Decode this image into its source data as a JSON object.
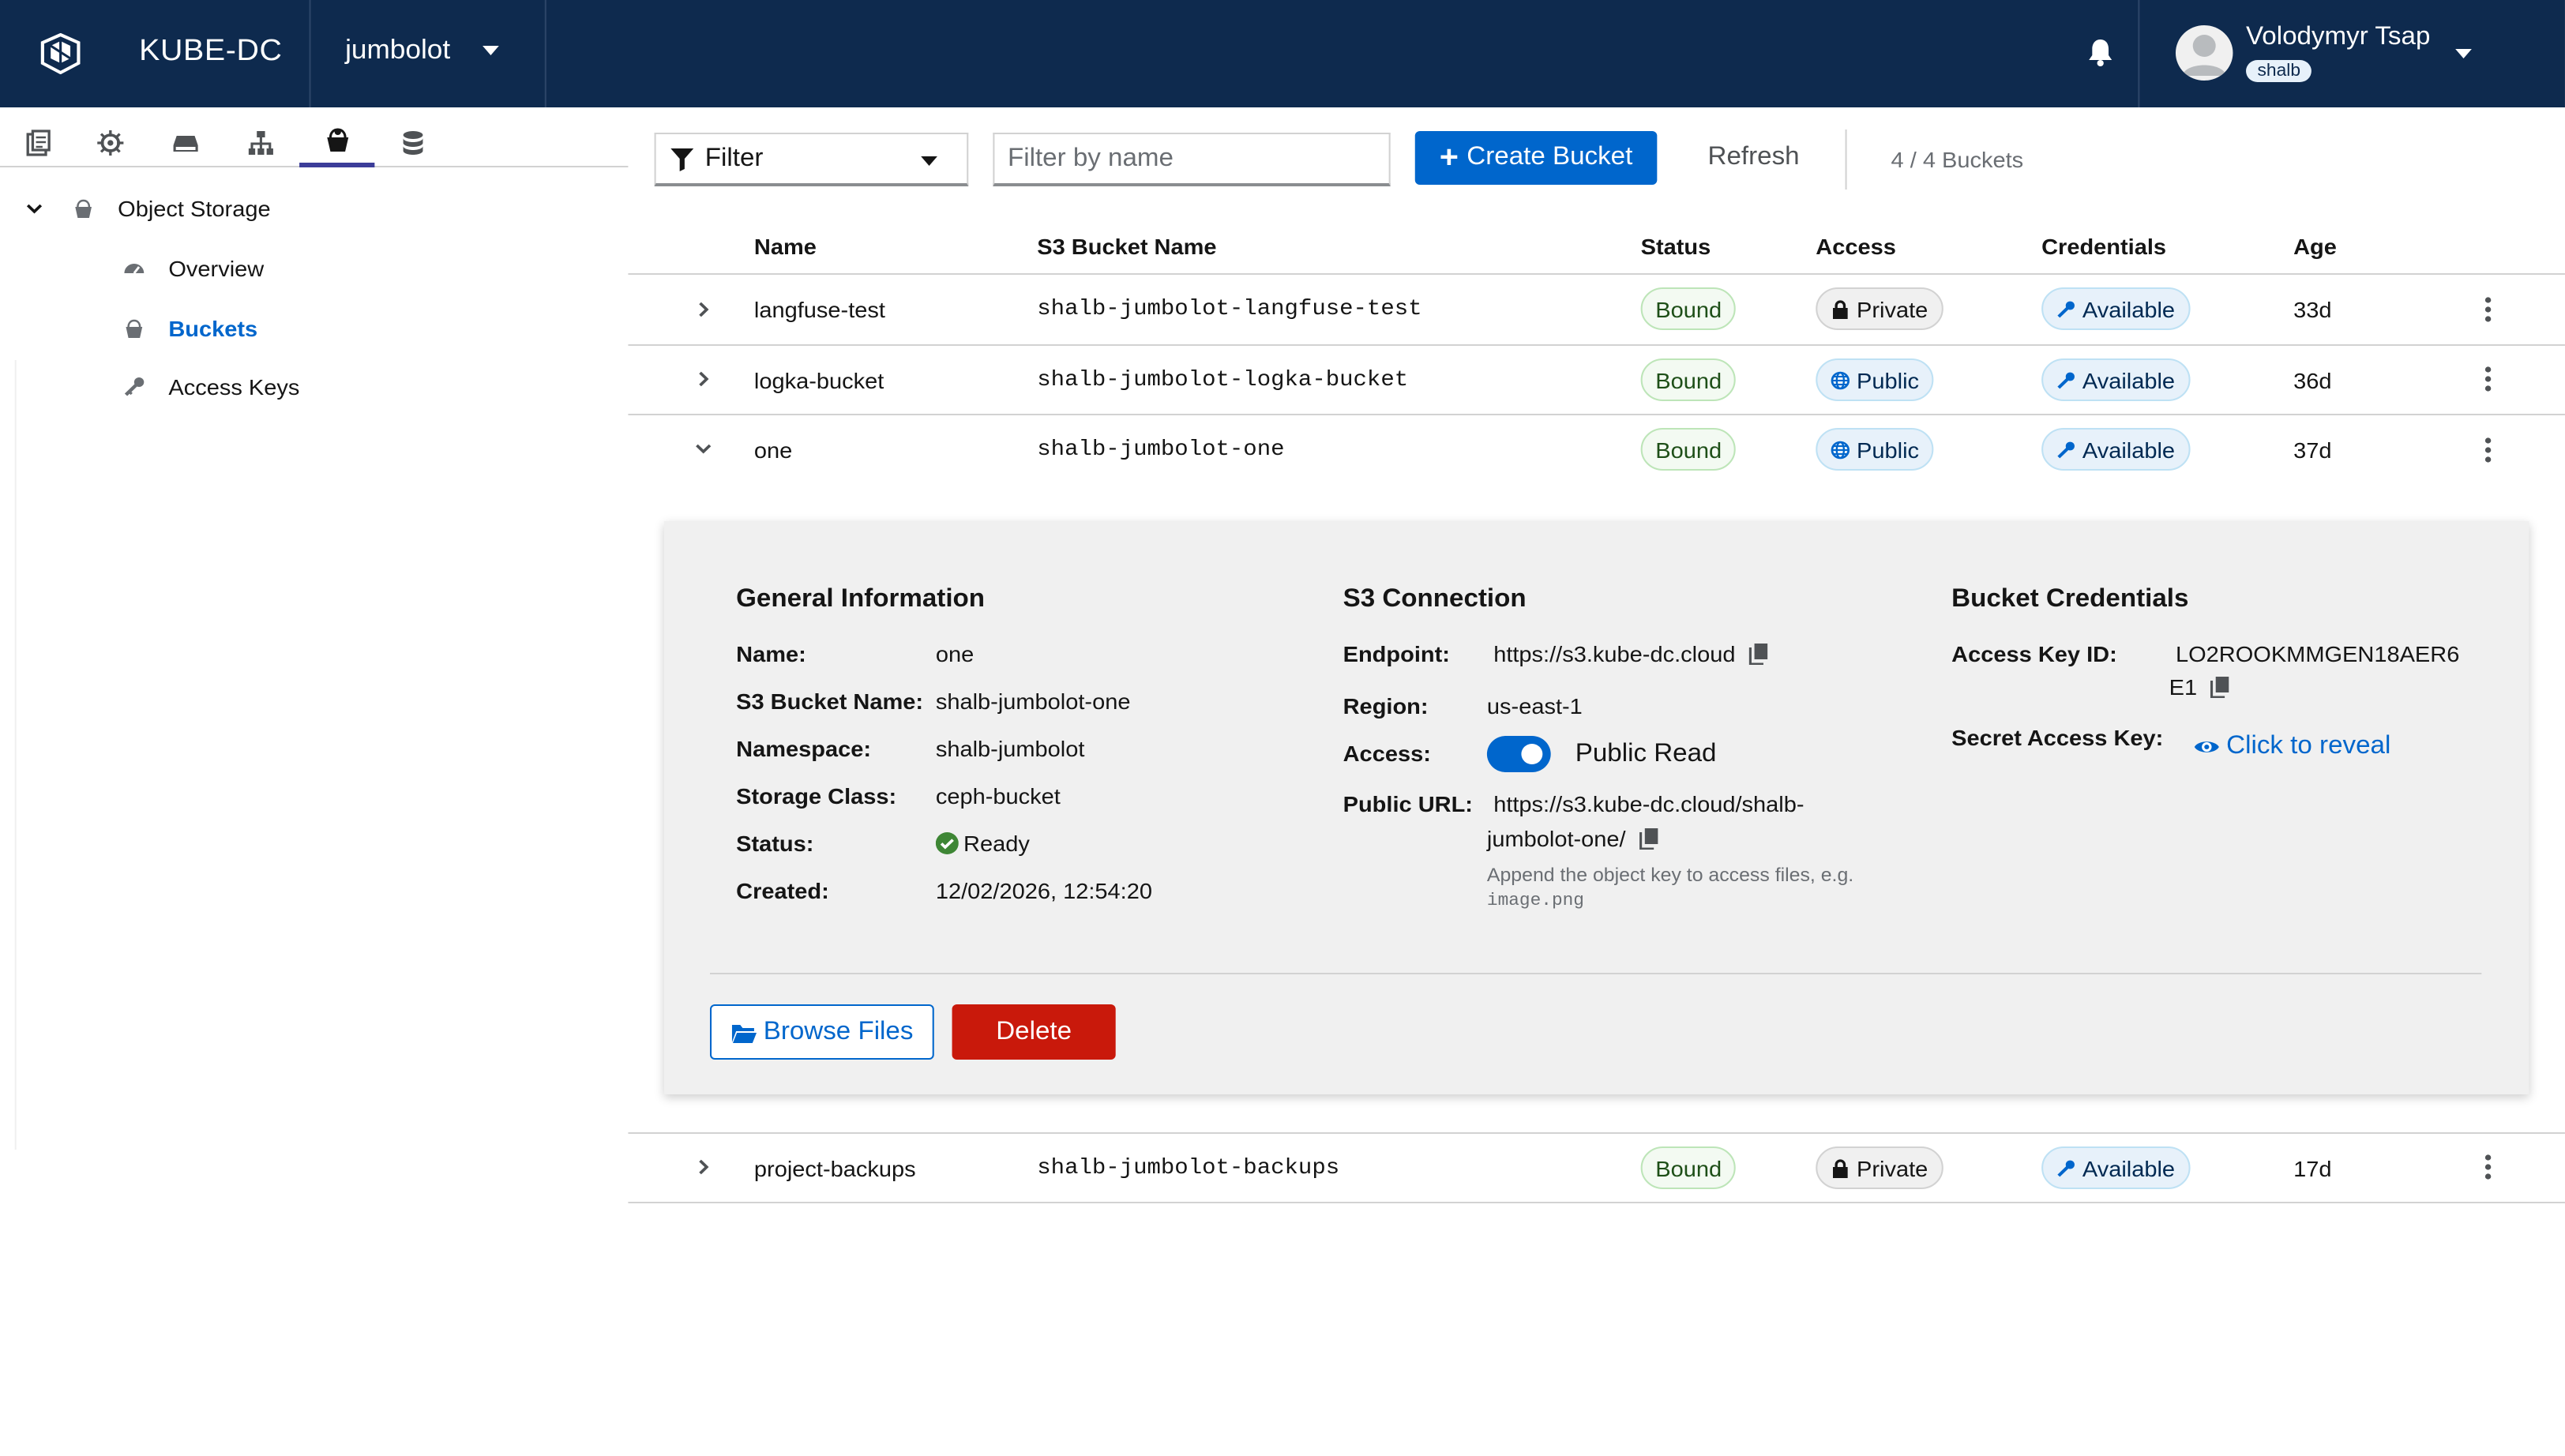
{
  "header": {
    "brand": "KUBE-DC",
    "project": "jumbolot",
    "user_name": "Volodymyr Tsap",
    "user_badge": "shalb"
  },
  "sidebar": {
    "tabs": [
      "documents-icon",
      "helm-icon",
      "hard-drive-icon",
      "network-icon",
      "bucket-icon",
      "database-icon"
    ],
    "active_tab": "bucket-icon",
    "root_label": "Object Storage",
    "items": [
      {
        "label": "Overview",
        "icon": "dashboard-icon"
      },
      {
        "label": "Buckets",
        "icon": "bucket-icon",
        "active": true
      },
      {
        "label": "Access Keys",
        "icon": "key-icon"
      }
    ]
  },
  "toolbar": {
    "filter_label": "Filter",
    "filter_placeholder": "Filter by name",
    "create_label": "Create Bucket",
    "refresh_label": "Refresh",
    "count_label": "4 / 4 Buckets"
  },
  "table": {
    "columns": [
      "Name",
      "S3 Bucket Name",
      "Status",
      "Access",
      "Credentials",
      "Age"
    ],
    "rows": [
      {
        "name": "langfuse-test",
        "s3_name": "shalb-jumbolot-langfuse-test",
        "status": "Bound",
        "access": "Private",
        "credentials": "Available",
        "age": "33d"
      },
      {
        "name": "logka-bucket",
        "s3_name": "shalb-jumbolot-logka-bucket",
        "status": "Bound",
        "access": "Public",
        "credentials": "Available",
        "age": "36d"
      },
      {
        "name": "one",
        "s3_name": "shalb-jumbolot-one",
        "status": "Bound",
        "access": "Public",
        "credentials": "Available",
        "age": "37d",
        "expanded": true
      },
      {
        "name": "project-backups",
        "s3_name": "shalb-jumbolot-backups",
        "status": "Bound",
        "access": "Private",
        "credentials": "Available",
        "age": "17d"
      }
    ]
  },
  "detail": {
    "general": {
      "title": "General Information",
      "name_label": "Name:",
      "name": "one",
      "s3_label": "S3 Bucket Name:",
      "s3": "shalb-jumbolot-one",
      "ns_label": "Namespace:",
      "ns": "shalb-jumbolot",
      "class_label": "Storage Class:",
      "class": "ceph-bucket",
      "status_label": "Status:",
      "status": "Ready",
      "created_label": "Created:",
      "created": "12/02/2026, 12:54:20"
    },
    "s3": {
      "title": "S3 Connection",
      "endpoint_label": "Endpoint:",
      "endpoint": "https://s3.kube-dc.cloud",
      "region_label": "Region:",
      "region": "us-east-1",
      "access_label": "Access:",
      "access": "Public Read",
      "url_label": "Public URL:",
      "url_line1": "https://s3.kube-dc.cloud/shalb-",
      "url_line2": "jumbolot-one/",
      "hint_line1": "Append the object key to access files, e.g.",
      "hint_code": "image.png"
    },
    "creds": {
      "title": "Bucket Credentials",
      "key_label": "Access Key ID:",
      "key_line1": "LO2ROOKMMGEN18AER6",
      "key_line2": "E1",
      "secret_label": "Secret Access Key:",
      "reveal": "Click to reveal"
    },
    "browse_label": "Browse Files",
    "delete_label": "Delete"
  },
  "colors": {
    "masthead": "#0e2a4e",
    "primary": "#0066cc",
    "danger": "#c9190b",
    "success": "#3e8635"
  }
}
